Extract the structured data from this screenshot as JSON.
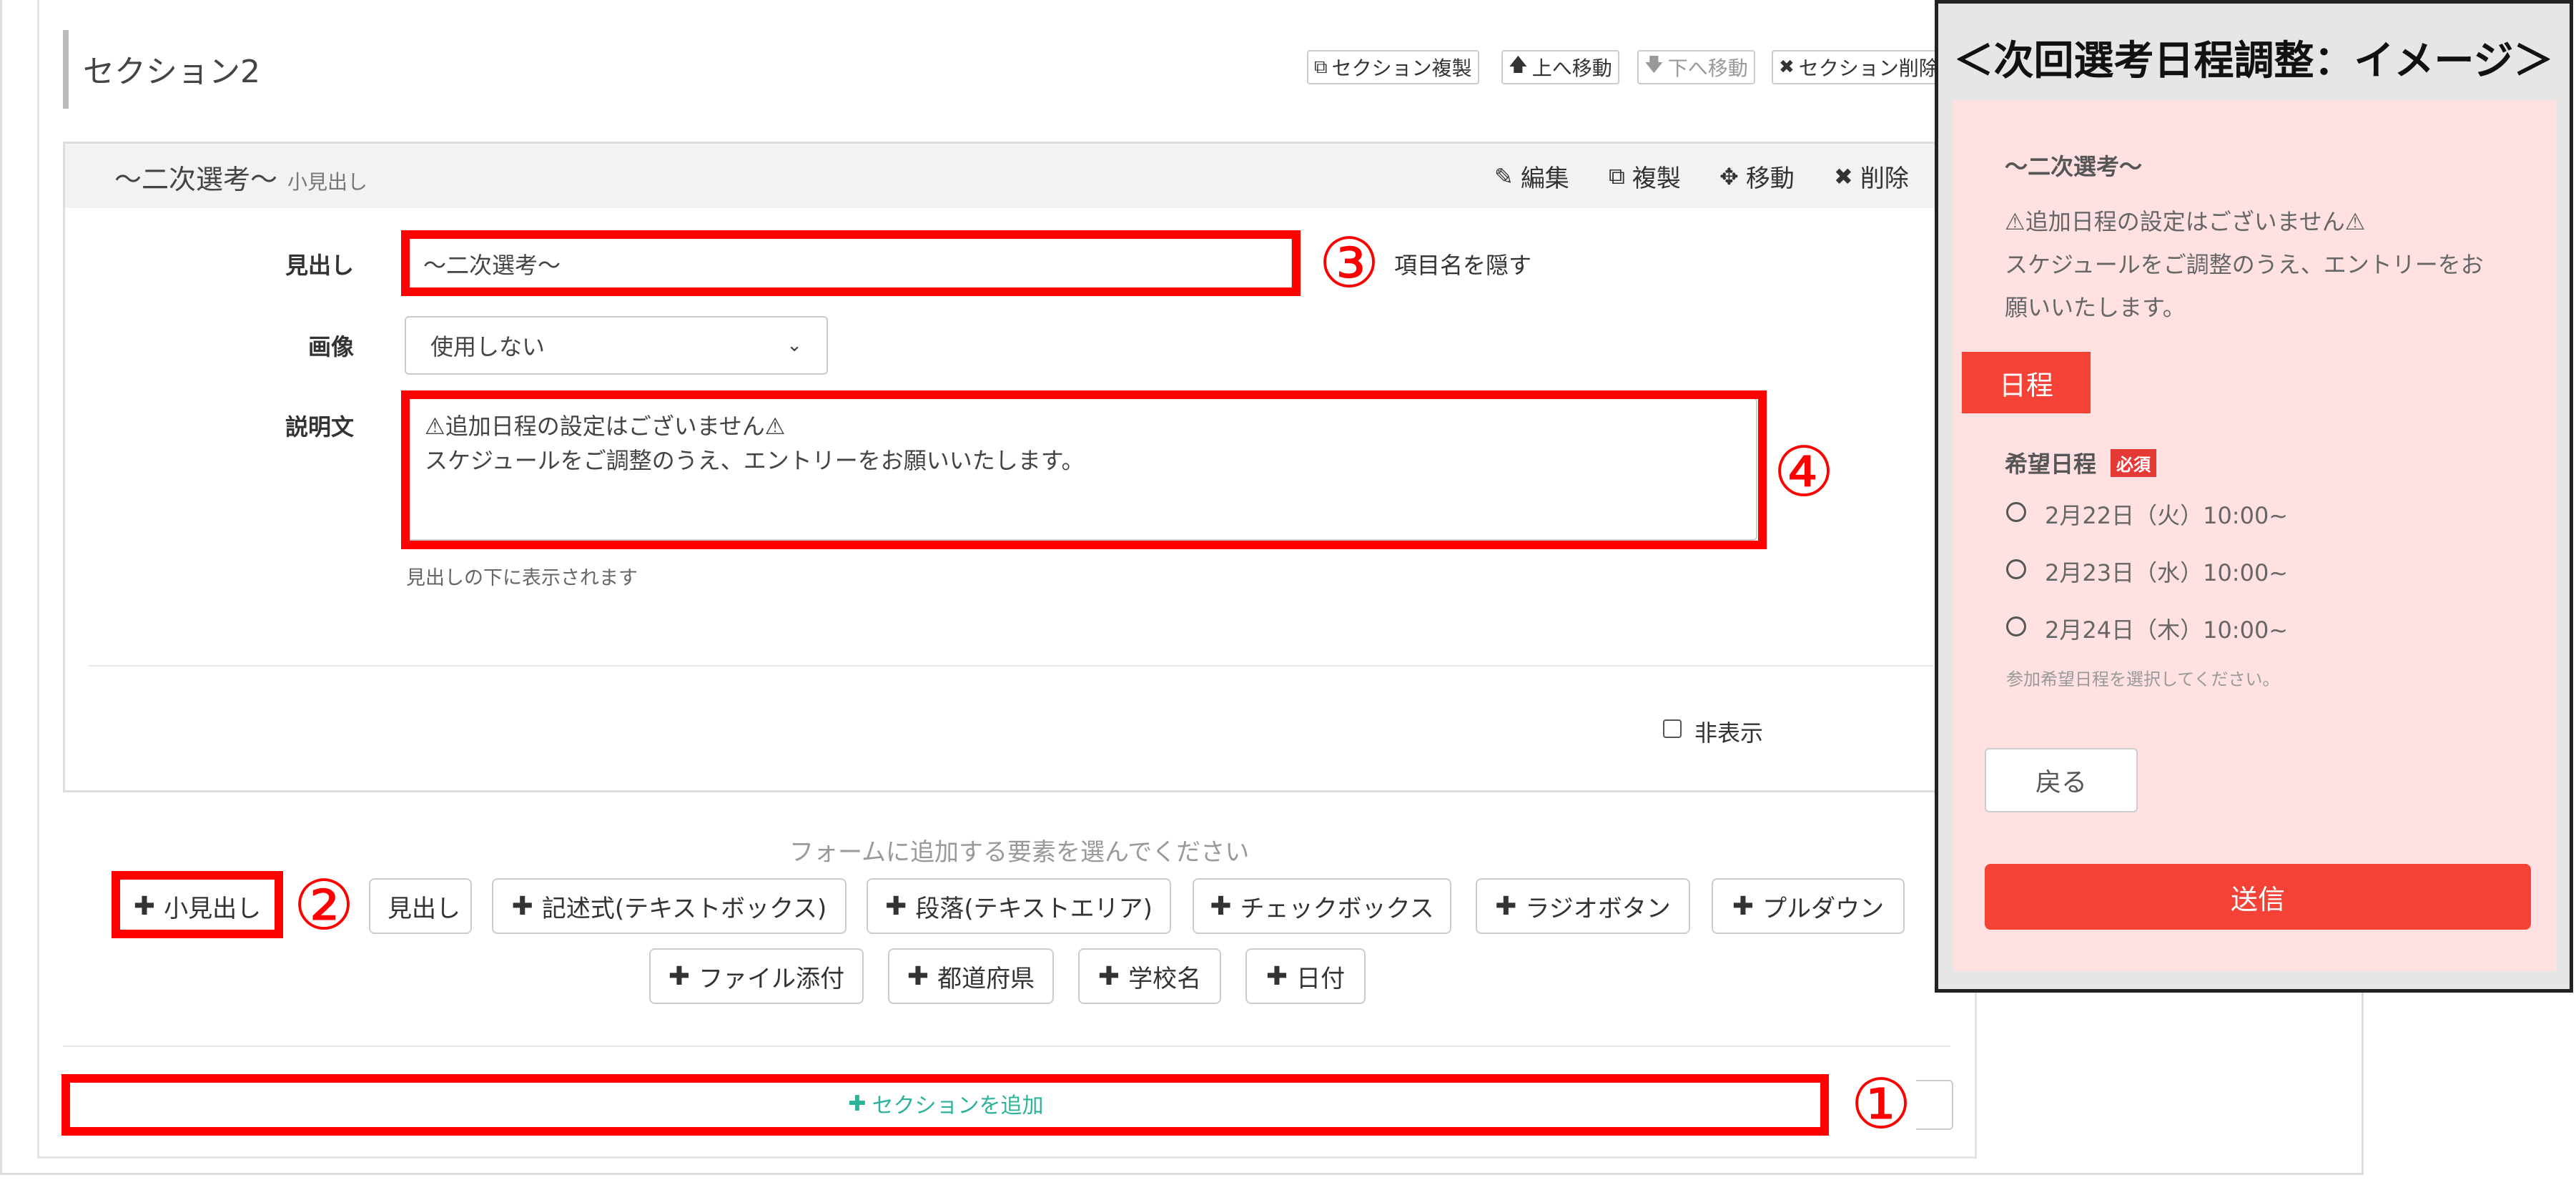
{
  "section": {
    "title": "セクション2",
    "toolbar": {
      "duplicate": "セクション複製",
      "move_up": "上へ移動",
      "move_down": "下へ移動",
      "delete": "セクション削除"
    }
  },
  "item": {
    "title": "～二次選考～",
    "subtitle": "小見出し",
    "actions": {
      "edit": "編集",
      "duplicate": "複製",
      "move": "移動",
      "delete": "削除"
    },
    "heading_label": "見出し",
    "heading_value": "～二次選考～",
    "hide_label": "項目名を隠す",
    "image_label": "画像",
    "image_value": "使用しない",
    "description_label": "説明文",
    "description_line1": "⚠追加日程の設定はございません⚠",
    "description_line2": "スケジュールをご調整のうえ、エントリーをお願いいたします。",
    "description_help": "見出しの下に表示されます",
    "hidden_checkbox_label": "非表示"
  },
  "add_elements": {
    "prompt": "フォームに追加する要素を選んでください",
    "buttons_row1": [
      "小見出し",
      "見出し",
      "記述式(テキストボックス)",
      "段落(テキストエリア)",
      "チェックボックス",
      "ラジオボタン",
      "プルダウン"
    ],
    "buttons_row2": [
      "ファイル添付",
      "都道府県",
      "学校名",
      "日付"
    ]
  },
  "add_section": "セクションを追加",
  "annotations": {
    "n1": "①",
    "n2": "②",
    "n3": "③",
    "n4": "④"
  },
  "preview": {
    "title": "＜次回選考日程調整：イメージ＞",
    "heading": "～二次選考～",
    "line1": "⚠追加日程の設定はございません⚠",
    "line2": "スケジュールをご調整のうえ、エントリーをお",
    "line3": "願いいたします。",
    "tag": "日程",
    "field_label": "希望日程",
    "required": "必須",
    "options": [
      "2月22日（火）10:00~",
      "2月23日（水）10:00~",
      "2月24日（木）10:00~"
    ],
    "help": "参加希望日程を選択してください。",
    "back": "戻る",
    "submit": "送信"
  },
  "colors": {
    "annotation_red": "#ff0000",
    "preview_bg": "#ffe1e1",
    "submit_bg": "#f44336",
    "add_section_text": "#2bb39a"
  }
}
